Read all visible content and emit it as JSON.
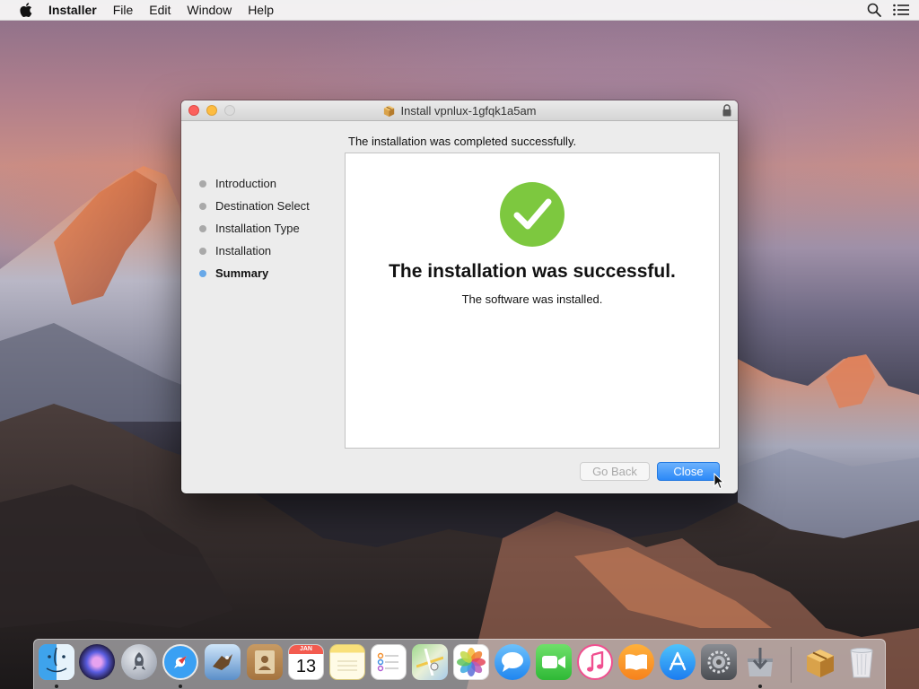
{
  "menubar": {
    "app_name": "Installer",
    "items": [
      "File",
      "Edit",
      "Window",
      "Help"
    ]
  },
  "window": {
    "title": "Install vpnlux-1gfqk1a5am",
    "status_text": "The installation was completed successfully.",
    "steps": [
      {
        "label": "Introduction",
        "current": false
      },
      {
        "label": "Destination Select",
        "current": false
      },
      {
        "label": "Installation Type",
        "current": false
      },
      {
        "label": "Installation",
        "current": false
      },
      {
        "label": "Summary",
        "current": true
      }
    ],
    "headline": "The installation was successful.",
    "subtext": "The software was installed.",
    "buttons": {
      "back_label": "Go Back",
      "close_label": "Close"
    },
    "success_color": "#7dc83f",
    "accent_color": "#2b88f7"
  },
  "dock": {
    "apps": [
      {
        "icon": "finder-icon",
        "running": true
      },
      {
        "icon": "siri-icon",
        "running": false
      },
      {
        "icon": "launchpad-icon",
        "running": false
      },
      {
        "icon": "safari-icon",
        "running": true
      },
      {
        "icon": "mail-icon",
        "running": false
      },
      {
        "icon": "contacts-icon",
        "running": false
      },
      {
        "icon": "calendar-icon",
        "running": false
      },
      {
        "icon": "notes-icon",
        "running": false
      },
      {
        "icon": "reminders-icon",
        "running": false
      },
      {
        "icon": "maps-icon",
        "running": false
      },
      {
        "icon": "photos-icon",
        "running": false
      },
      {
        "icon": "messages-icon",
        "running": false
      },
      {
        "icon": "facetime-icon",
        "running": false
      },
      {
        "icon": "itunes-icon",
        "running": false
      },
      {
        "icon": "ibooks-icon",
        "running": false
      },
      {
        "icon": "app-store-icon",
        "running": false
      },
      {
        "icon": "system-preferences-icon",
        "running": false
      },
      {
        "icon": "installer-icon",
        "running": true
      },
      {
        "icon": "package-icon",
        "running": false
      },
      {
        "icon": "trash-icon",
        "running": false
      }
    ],
    "calendar": {
      "month": "JAN",
      "day": "13"
    }
  }
}
